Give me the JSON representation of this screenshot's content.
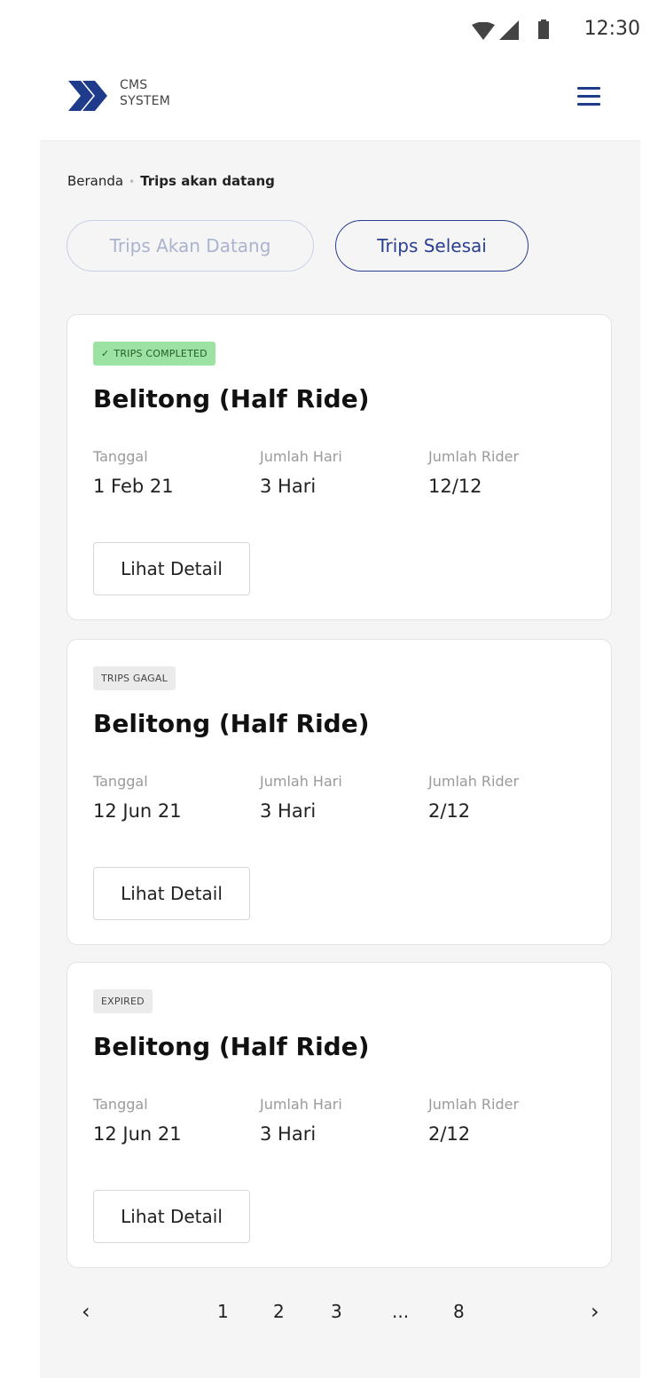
{
  "status_bar": {
    "time": "12:30",
    "icons": [
      "wifi-icon",
      "signal-icon",
      "battery-icon"
    ]
  },
  "header": {
    "logo_line1": "CMS",
    "logo_line2": "SYSTEM",
    "menu_icon": "hamburger-menu-icon"
  },
  "breadcrumb": {
    "home": "Beranda",
    "separator": "•",
    "current": "Trips akan datang"
  },
  "tabs": {
    "upcoming": "Trips Akan Datang",
    "done": "Trips Selesai",
    "active": "done"
  },
  "cards": [
    {
      "badge": "TRIPS COMPLETED",
      "badge_color": "#9ce3a3",
      "title": "Belitong (Half Ride)",
      "date_label": "Tanggal",
      "date": "1 Feb 21",
      "days_label": "Jumlah Hari",
      "days": "3 Hari",
      "riders_label": "Jumlah Rider",
      "riders": "12/12",
      "button": "Lihat Detail"
    },
    {
      "badge": "TRIPS GAGAL",
      "badge_color": "#ebebeb",
      "title": "Belitong (Half Ride)",
      "date_label": "Tanggal",
      "date": "12 Jun 21",
      "days_label": "Jumlah Hari",
      "days": "3 Hari",
      "riders_label": "Jumlah Rider",
      "riders": "2/12",
      "button": "Lihat Detail"
    },
    {
      "badge": "EXPIRED",
      "badge_color": "#ebebeb",
      "title": "Belitong (Half Ride)",
      "date_label": "Tanggal",
      "date": "12 Jun 21",
      "days_label": "Jumlah Hari",
      "days": "3 Hari",
      "riders_label": "Jumlah Rider",
      "riders": "2/12",
      "button": "Lihat Detail"
    }
  ],
  "pagination": {
    "prev": "‹",
    "pages": [
      "1",
      "2",
      "3",
      "...",
      "8"
    ],
    "next": "›"
  },
  "colors": {
    "brand": "#1f3b8c",
    "background": "#f5f5f5"
  }
}
